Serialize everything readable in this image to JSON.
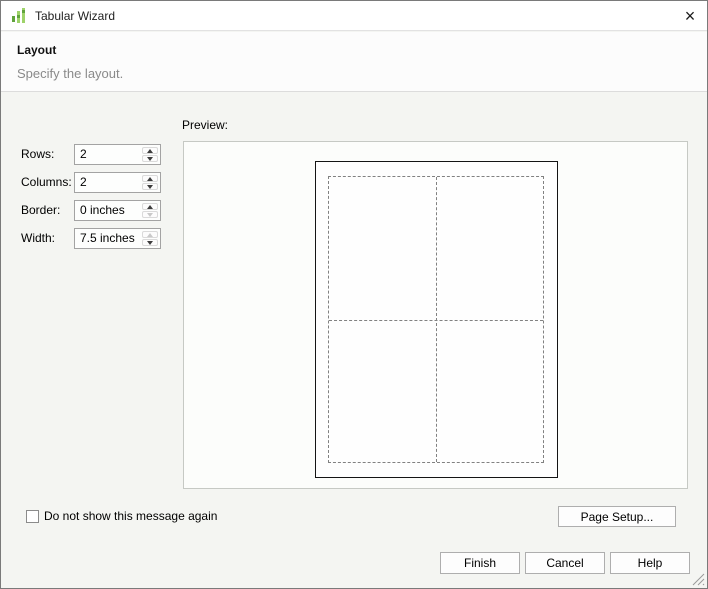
{
  "window": {
    "title": "Tabular Wizard",
    "close_glyph": "×"
  },
  "header": {
    "title": "Layout",
    "subtitle": "Specify the layout."
  },
  "form": {
    "fields": [
      {
        "label": "Rows:",
        "value": "2",
        "up_enabled": true,
        "down_enabled": true
      },
      {
        "label": "Columns:",
        "value": "2",
        "up_enabled": true,
        "down_enabled": true
      },
      {
        "label": "Border:",
        "value": "0 inches",
        "up_enabled": true,
        "down_enabled": false
      },
      {
        "label": "Width:",
        "value": "7.5 inches",
        "up_enabled": false,
        "down_enabled": true
      }
    ]
  },
  "preview": {
    "label": "Preview:",
    "rows": 2,
    "columns": 2
  },
  "footer": {
    "checkbox_label": "Do not show this message again",
    "checkbox_checked": false,
    "page_setup_label": "Page Setup...",
    "finish_label": "Finish",
    "cancel_label": "Cancel",
    "help_label": "Help"
  },
  "icons": {
    "app": "green-equalizer-bars",
    "close": "x-glyph",
    "spinner_up": "triangle-up",
    "spinner_down": "triangle-down",
    "resize_grip": "diagonal-lines"
  },
  "colors": {
    "accent_green_light": "#9ed36a",
    "accent_green_dark": "#61a33c",
    "page_border": "#141414",
    "grid_dash": "#818181"
  }
}
